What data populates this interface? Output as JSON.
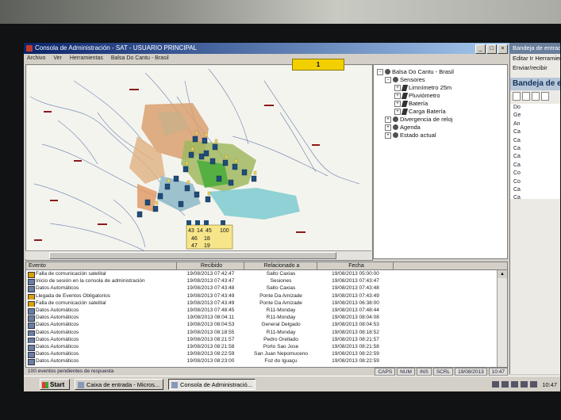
{
  "window": {
    "title": "Consola de Administración - SAT - USUARIO PRINCIPAL",
    "menu": [
      "Archivo",
      "Ver",
      "Herramientas",
      "Balsa Do Cantu - Brasil"
    ]
  },
  "map": {
    "badge": "1",
    "site_labels": [
      "43",
      "14",
      "45",
      "100",
      "46",
      "18",
      "47",
      "19"
    ]
  },
  "tree": {
    "root": "Balsa Do Cantu - Brasil",
    "sensores": "Sensores",
    "sensor_items": [
      "Limnímetro 25m",
      "Pluviómetro",
      "Batería",
      "Carga Batería"
    ],
    "other_items": [
      "Divergencia de reloj",
      "Agenda",
      "Estado actual"
    ]
  },
  "grid": {
    "columns": [
      "Evento",
      "Recibido",
      "Relacionado a",
      "Fecha"
    ],
    "rows": [
      {
        "evento": "Falla de comunicación satelital",
        "recibido": "19/08/2013 07:42:47",
        "rel": "Salto Caxias",
        "fecha": "19/08/2013 05:00:00",
        "icon": "satellite-warning-icon"
      },
      {
        "evento": "Inicio de sesión en la consola de administración",
        "recibido": "19/08/2013 07:43:47",
        "rel": "Sesiones",
        "fecha": "19/08/2013 07:43:47",
        "icon": "session-icon"
      },
      {
        "evento": "Datos Automáticos",
        "recibido": "19/08/2013 07:43:48",
        "rel": "Salto Caxias",
        "fecha": "19/08/2013 07:43:48",
        "icon": "data-icon"
      },
      {
        "evento": "Llegada de Eventos Obligatorios",
        "recibido": "19/08/2013 07:43:49",
        "rel": "Ponte Da Amizade",
        "fecha": "19/08/2013 07:43:49",
        "icon": "event-warning-icon"
      },
      {
        "evento": "Falla de comunicación satelital",
        "recibido": "19/08/2013 07:43:49",
        "rel": "Ponte Da Amizade",
        "fecha": "19/08/2013 06:38:00",
        "icon": "satellite-warning-icon"
      },
      {
        "evento": "Datos Automáticos",
        "recibido": "19/08/2013 07:48:45",
        "rel": "R11-Monday",
        "fecha": "19/08/2013 07:48:44",
        "icon": "data-icon"
      },
      {
        "evento": "Datos Automáticos",
        "recibido": "19/08/2013 08:04:11",
        "rel": "R11-Monday",
        "fecha": "19/08/2013 08:04:08",
        "icon": "data-icon"
      },
      {
        "evento": "Datos Automáticos",
        "recibido": "19/08/2013 08:04:53",
        "rel": "General Delgado",
        "fecha": "19/08/2013 08:04:53",
        "icon": "data-icon"
      },
      {
        "evento": "Datos Automáticos",
        "recibido": "19/08/2013 08:18:55",
        "rel": "R11-Monday",
        "fecha": "19/08/2013 08:18:52",
        "icon": "data-icon"
      },
      {
        "evento": "Datos Automáticos",
        "recibido": "19/08/2013 08:21:57",
        "rel": "Pedro Orellado",
        "fecha": "19/08/2013 08:21:57",
        "icon": "data-icon"
      },
      {
        "evento": "Datos Automáticos",
        "recibido": "19/08/2013 08:21:58",
        "rel": "Porto Sao Jose",
        "fecha": "19/08/2013 08:21:58",
        "icon": "data-icon"
      },
      {
        "evento": "Datos Automáticos",
        "recibido": "19/08/2013 08:22:59",
        "rel": "San Juan Nepomuceno",
        "fecha": "19/08/2013 08:22:59",
        "icon": "data-icon"
      },
      {
        "evento": "Datos Automáticos",
        "recibido": "19/08/2013 08:23:00",
        "rel": "Foz do Iguaçu",
        "fecha": "19/08/2013 08:22:59",
        "icon": "data-icon"
      }
    ]
  },
  "status": {
    "message": "100 eventos pendientes de respuesta",
    "indicators": [
      "CAPS",
      "NUM",
      "INS",
      "SCRL"
    ],
    "datetime": "19/08/2013",
    "time": "10:47"
  },
  "second_window": {
    "title": "Bandeja de entrada",
    "menu1": "Editar  Ir  Herramientas",
    "menu2": "Enviar/recibir",
    "header": "Bandeja de entrada",
    "list": [
      "Do",
      "Ge",
      "An",
      "Ca",
      "Ca",
      "Ca",
      "Ca",
      "Ca",
      "Co",
      "Co",
      "Ca",
      "Ca"
    ]
  },
  "taskbar": {
    "start": "Start",
    "buttons": [
      "Caixa de entrada - Micros...",
      "Consola de Administració..."
    ],
    "clock": "10:47"
  }
}
